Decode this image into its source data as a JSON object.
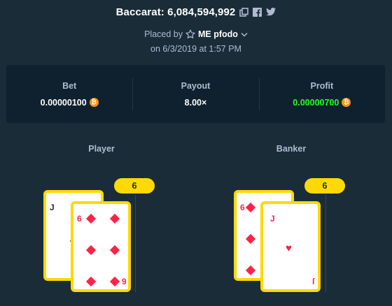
{
  "header": {
    "title": "Baccarat: 6,084,594,992",
    "copy_icon": "copy-icon",
    "facebook_icon": "facebook-icon",
    "twitter_icon": "twitter-icon"
  },
  "placed": {
    "prefix": "Placed by",
    "star_icon": "star-icon",
    "user": "ME pfodo",
    "chevron_icon": "chevron-down-icon",
    "date_text": "on 6/3/2019 at 1:57 PM"
  },
  "stats": {
    "bet_label": "Bet",
    "bet_value": "0.00000100",
    "payout_label": "Payout",
    "payout_value": "8.00×",
    "profit_label": "Profit",
    "profit_value": "0.00000700",
    "currency_icon": "bitcoin-icon",
    "currency_symbol": "₿",
    "profit_color": "#1fff20"
  },
  "player": {
    "label": "Player",
    "score": "6",
    "cards": [
      {
        "rank": "J",
        "suit": "diamond"
      },
      {
        "rank": "6",
        "suit": "diamond",
        "bottom_rank": "9"
      }
    ]
  },
  "banker": {
    "label": "Banker",
    "score": "6",
    "cards": [
      {
        "rank": "6",
        "suit": "diamond"
      },
      {
        "rank": "J",
        "suit": "heart",
        "bottom_rank": "ſ"
      }
    ]
  },
  "colors": {
    "background": "#1a2c38",
    "panel": "#0f212e",
    "accent": "#ffd900",
    "red": "#fe2247",
    "muted": "#b1bad3"
  }
}
